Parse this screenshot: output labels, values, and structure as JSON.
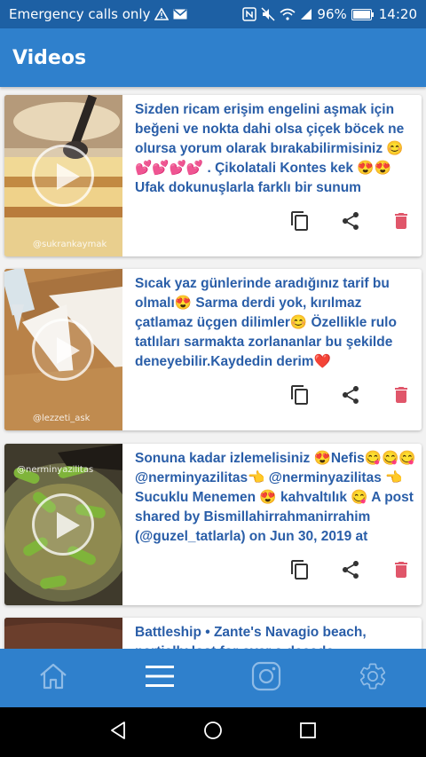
{
  "status_bar": {
    "carrier": "Emergency calls only",
    "battery": "96%",
    "time": "14:20"
  },
  "app_bar": {
    "title": "Videos"
  },
  "videos": [
    {
      "watermark": "@sukrankaymak",
      "caption": "Sizden ricam erişim engelini aşmak için beğeni ve nokta dahi olsa çiçek böcek ne olursa yorum olarak bırakabilirmisiniz 😊💕💕💕💕 . Çikolatali Kontes kek 😍😍Ufak dokunuşlarla farklı bir sunum"
    },
    {
      "watermark": "@lezzeti_ask",
      "caption": "Sıcak yaz günlerinde aradığınız tarif bu olmalı😍 Sarma derdi yok, kırılmaz çatlamaz üçgen dilimler😊 Özellikle rulo tatlıları sarmakta zorlananlar bu şekilde deneyebilir.Kaydedin derim❤️"
    },
    {
      "watermark": "@nerminyazilitas",
      "caption": "Sonuna kadar izlemelisiniz 😍Nefis😋😋😋 @nerminyazilitas👈 @nerminyazilitas 👈 Sucuklu Menemen 😍 kahvaltılık 😋 A post shared by Bismillahirrahmanirrahim (@guzel_tatlarla) on Jun 30, 2019 at"
    },
    {
      "watermark": "",
      "caption": "Battleship • Zante's Navagio beach, partially lost for over a decade"
    }
  ],
  "colors": {
    "primary": "#2f80cc",
    "status_bar": "#1d60a4",
    "caption_text": "#2a5ea8",
    "delete_icon": "#e0566a",
    "action_icon": "#333333"
  },
  "icons": {
    "copy": "copy-icon",
    "share": "share-icon",
    "delete": "delete-icon",
    "home": "home-icon",
    "menu": "menu-icon",
    "instagram": "instagram-icon",
    "settings": "settings-icon"
  }
}
